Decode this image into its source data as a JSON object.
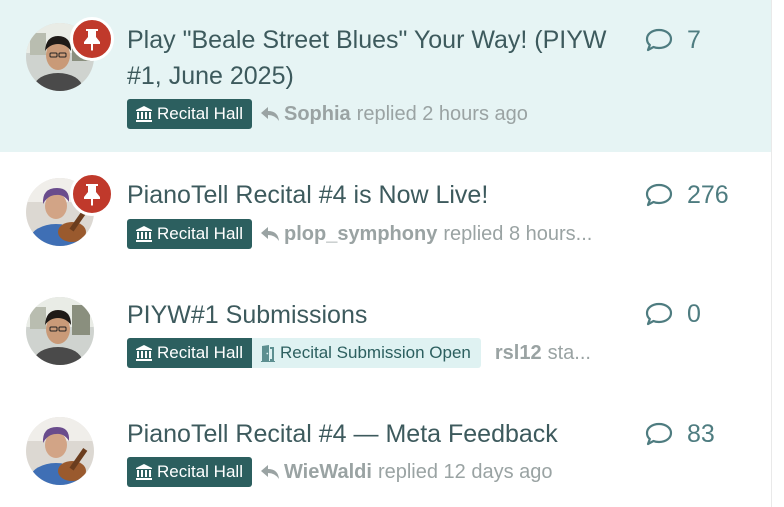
{
  "topics": [
    {
      "title": "Play \"Beale Street Blues\" Your Way! (PIYW #1, June 2025)",
      "category": "Recital Hall",
      "status_tag": "",
      "user": "Sophia",
      "activity": "replied 2 hours ago",
      "replies": "7",
      "pinned": true,
      "highlighted": true,
      "avatar_icon": "person-photo-avatar-icon"
    },
    {
      "title": "PianoTell Recital #4 is Now Live!",
      "category": "Recital Hall",
      "status_tag": "",
      "user": "plop_symphony",
      "activity": "replied 8 hours...",
      "replies": "276",
      "pinned": true,
      "highlighted": false,
      "avatar_icon": "guitarist-avatar-icon"
    },
    {
      "title": "PIYW#1 Submissions",
      "category": "Recital Hall",
      "status_tag": "Recital Submission Open",
      "user": "rsl12",
      "activity": "sta...",
      "replies": "0",
      "pinned": false,
      "highlighted": false,
      "avatar_icon": "person-photo-avatar-icon"
    },
    {
      "title": "PianoTell Recital #4 — Meta Feedback",
      "category": "Recital Hall",
      "status_tag": "",
      "user": "WieWaldi",
      "activity": "replied 12 days ago",
      "replies": "83",
      "pinned": false,
      "highlighted": false,
      "avatar_icon": "guitarist-avatar-icon"
    }
  ],
  "colors": {
    "highlight_row": "#e6f4f4",
    "category_tag": "#2c5f5f",
    "status_tag": "#dff2f2",
    "pin_badge": "#c0392b",
    "title_text": "#3d5a5d",
    "muted_text": "#9aa3a3"
  }
}
